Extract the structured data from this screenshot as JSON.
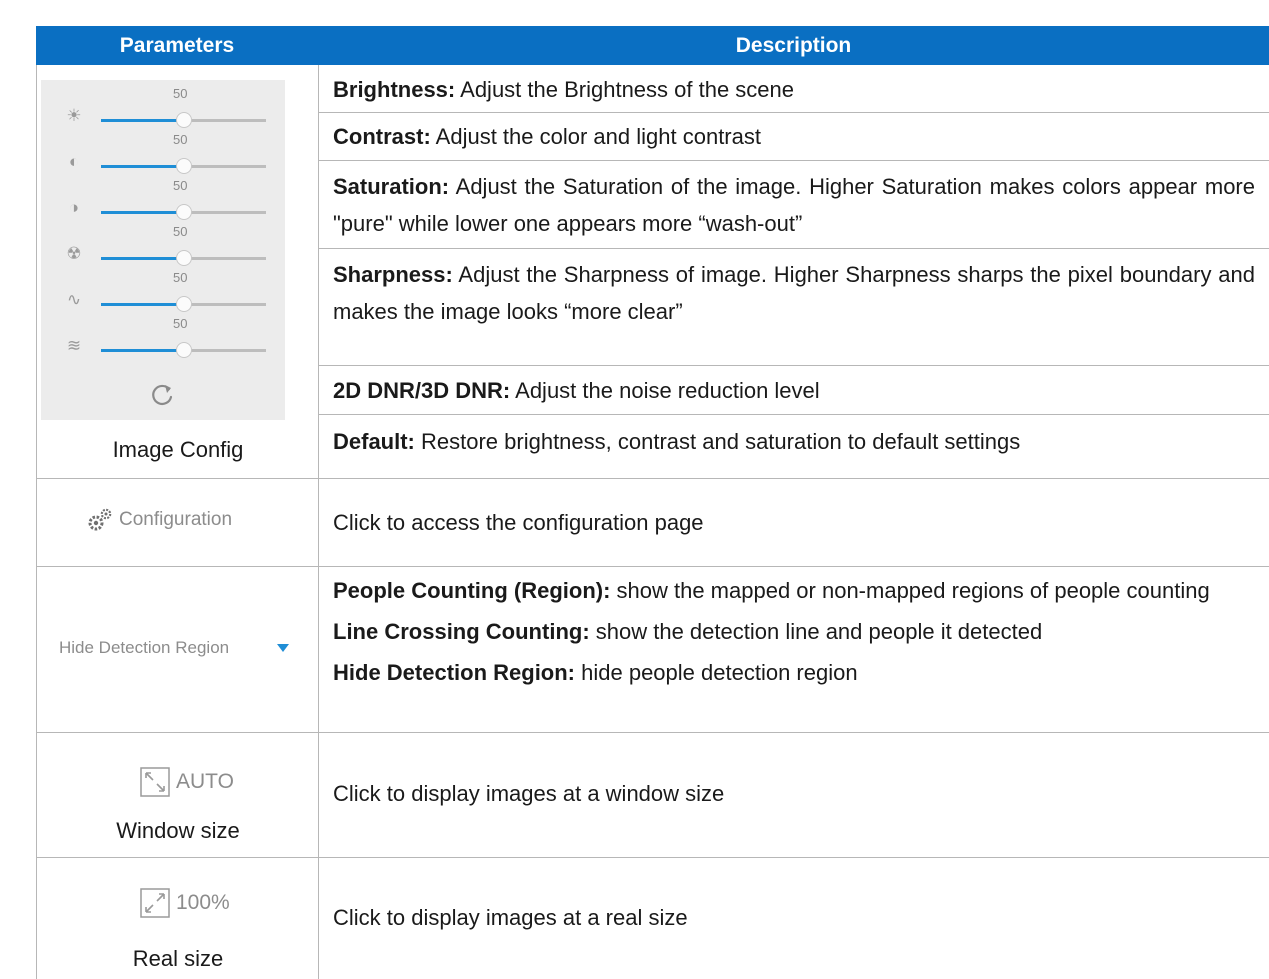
{
  "header": {
    "parameters": "Parameters",
    "description": "Description"
  },
  "image_config": {
    "caption": "Image Config",
    "sliders": [
      {
        "icon": "brightness-icon",
        "value": "50",
        "level": 0.5
      },
      {
        "icon": "contrast-icon",
        "value": "50",
        "level": 0.5
      },
      {
        "icon": "saturation-icon",
        "value": "50",
        "level": 0.5
      },
      {
        "icon": "sharpness-icon",
        "value": "50",
        "level": 0.5
      },
      {
        "icon": "dnr-2d-icon",
        "value": "50",
        "level": 0.5
      },
      {
        "icon": "dnr-3d-icon",
        "value": "50",
        "level": 0.5
      }
    ],
    "rows": [
      {
        "term": "Brightness:",
        "text": " Adjust the Brightness of the scene"
      },
      {
        "term": "Contrast:",
        "text": " Adjust the color and light contrast"
      },
      {
        "term": "Saturation:",
        "text": " Adjust the Saturation of the image. Higher Saturation makes colors appear more \"pure\" while lower one appears more “wash-out”"
      },
      {
        "term": "Sharpness:",
        "text": " Adjust the Sharpness of image. Higher Sharpness sharps the pixel boundary and makes the image looks “more clear”"
      },
      {
        "term": "2D DNR/3D DNR:",
        "text": " Adjust the noise reduction level"
      },
      {
        "term": "Default:",
        "text": " Restore brightness, contrast and saturation to default settings"
      }
    ]
  },
  "configuration": {
    "label": "Configuration",
    "description": "Click to access the configuration page"
  },
  "detection": {
    "selected": "Hide Detection Region",
    "items": [
      {
        "term": "People Counting (Region):",
        "text": " show the mapped or non-mapped regions of people counting"
      },
      {
        "term": "Line Crossing Counting:",
        "text": " show the detection line and people it detected"
      },
      {
        "term": "Hide Detection Region:",
        "text": " hide people detection region"
      }
    ]
  },
  "window_size": {
    "button": "AUTO",
    "caption": "Window size",
    "description": "Click to display images at a window size"
  },
  "real_size": {
    "button": "100%",
    "caption": "Real size",
    "description": "Click to display images at a real size"
  },
  "colors": {
    "header": "#0a6fc2",
    "slider_fill": "#1f8ed6",
    "dropdown_arrow": "#1f8ed6"
  }
}
